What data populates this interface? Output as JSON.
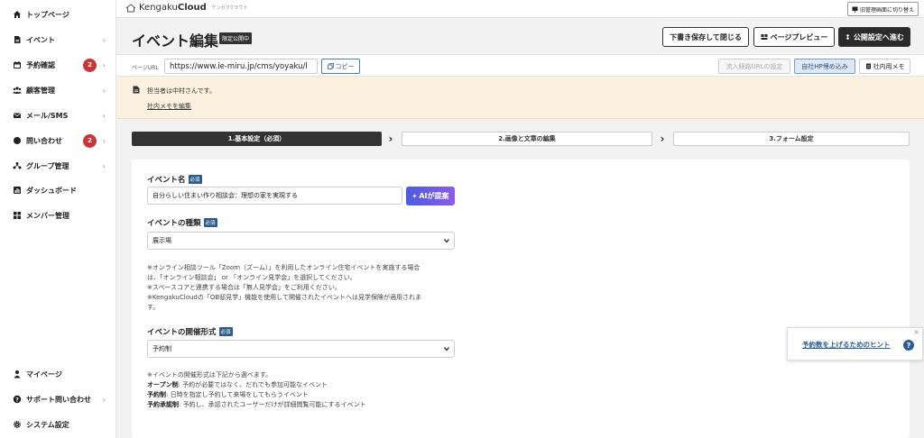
{
  "sidebar": {
    "items": [
      {
        "label": "トップページ",
        "icon": "home-icon"
      },
      {
        "label": "イベント",
        "icon": "document-icon"
      },
      {
        "label": "予約確認",
        "icon": "calendar-icon",
        "badge": "2"
      },
      {
        "label": "顧客管理",
        "icon": "users-icon"
      },
      {
        "label": "メール/SMS",
        "icon": "mail-icon"
      },
      {
        "label": "問い合わせ",
        "icon": "chat-icon",
        "badge": "2"
      },
      {
        "label": "グループ管理",
        "icon": "group-icon"
      },
      {
        "label": "ダッシュボード",
        "icon": "chart-icon"
      },
      {
        "label": "メンバー管理",
        "icon": "grid-icon"
      }
    ],
    "bottom_items": [
      {
        "label": "マイページ",
        "icon": "person-icon"
      },
      {
        "label": "サポート問い合わせ",
        "icon": "help-icon"
      },
      {
        "label": "システム設定",
        "icon": "gear-icon"
      }
    ],
    "chevron": "›"
  },
  "topbar": {
    "logo_text_light": "Kengaku",
    "logo_text_bold": "Cloud",
    "logo_sub": "ケンガククラウド",
    "old_admin_label": "旧管理画面に切り替え"
  },
  "header": {
    "title": "イベント編集",
    "tag": "限定公開中",
    "save_close_label": "下書き保存して閉じる",
    "preview_label": "ページプレビュー",
    "next_label": "公開設定へ進む"
  },
  "url_row": {
    "label": "ページURL",
    "url": "https://www.ie-miru.jp/cms/yoyaku/l",
    "copy_label": "コピー",
    "inflow_label": "流入経路URLの設定",
    "embed_label": "自社HP埋め込み",
    "memo_label": "社内用メモ"
  },
  "memo": {
    "text": "担当者は中村さんです。",
    "edit_link": "社内メモを編集"
  },
  "steps": [
    {
      "label": "1.基本設定（必須）"
    },
    {
      "label": "2.画像と文章の編集"
    },
    {
      "label": "3.フォーム設定"
    }
  ],
  "step_arrow": "›",
  "form": {
    "required_tag": "必須",
    "event_name_label": "イベント名",
    "event_name_value": "自分らしい住まい作り相談会：理想の家を実現する",
    "ai_label": "AIが提案",
    "event_type_label": "イベントの種類",
    "event_type_value": "展示場",
    "type_notes": [
      "※オンライン相談ツール「Zoom（ズーム）」を利用したオンライン住宅イベントを実施する場合",
      "は、「オンライン相談会」 or 「オンライン見学会」を選択してください。",
      "※スペースコアと連携する場合は「無人見学会」をご利用ください。",
      "※KengakuCloudの「OB邸見学」機能を使用して開催されたイベントへは見学保険が適用されま",
      "す。"
    ],
    "format_label": "イベントの開催形式",
    "format_value": "予約制",
    "format_note_head": "※イベントの開催形式は下記から選べます。",
    "format_notes": [
      {
        "term": "オープン制",
        "desc": ": 予約が必要ではなく、だれでも参加可能なイベント"
      },
      {
        "term": "予約制",
        "desc": ": 日時を指定し予約して来場をしてもらうイベント"
      },
      {
        "term": "予約承認制",
        "desc": ": 予約し、承認されたユーザーだけが詳細閲覧可能にするイベント"
      }
    ]
  },
  "hint": {
    "text": "予約数を上げるためのヒント",
    "q": "?",
    "close": "×"
  },
  "colors": {
    "accent": "#2e5c8a",
    "badge": "#c83737",
    "memo_bg": "#fbf1de",
    "dark": "#333333"
  }
}
